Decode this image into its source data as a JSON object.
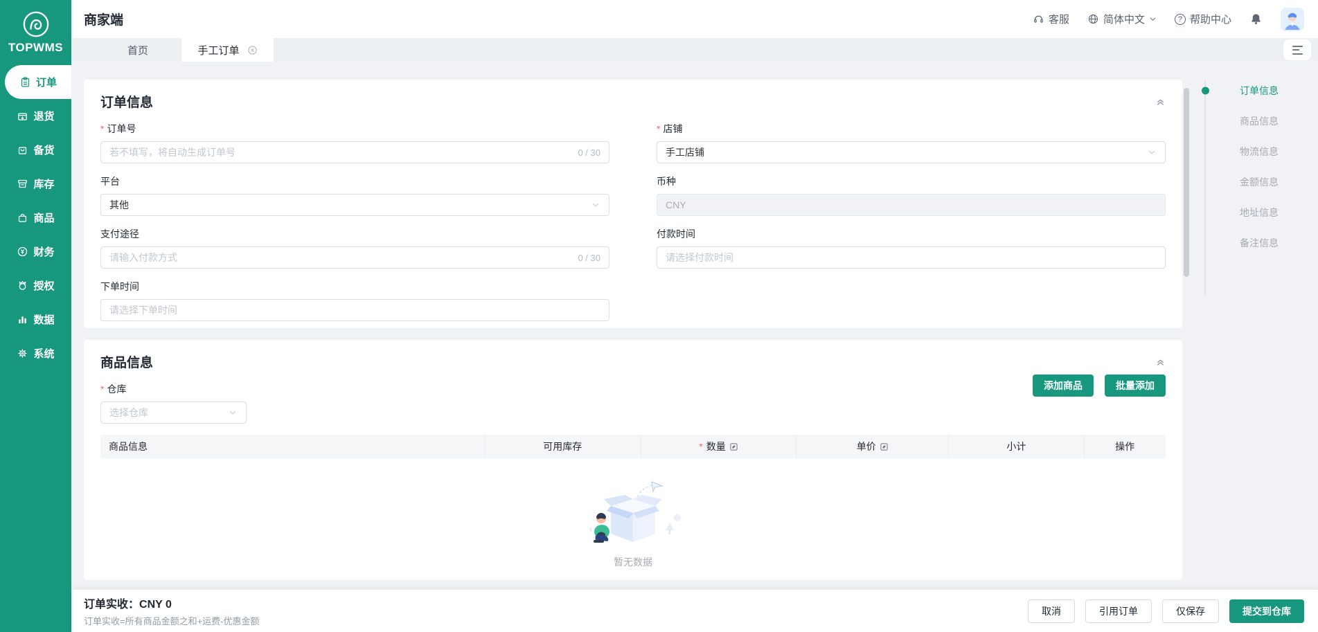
{
  "brand": {
    "name": "TOPWMS"
  },
  "topbar": {
    "title": "商家端",
    "customer_service": "客服",
    "language": "简体中文",
    "help_center": "帮助中心"
  },
  "tabs": [
    {
      "label": "首页",
      "active": false
    },
    {
      "label": "手工订单",
      "active": true,
      "closable": true
    }
  ],
  "sidebar": {
    "items": [
      {
        "label": "订单",
        "icon": "order-icon",
        "active": true
      },
      {
        "label": "退货",
        "icon": "returns-icon",
        "active": false
      },
      {
        "label": "备货",
        "icon": "stock-prep-icon",
        "active": false
      },
      {
        "label": "库存",
        "icon": "inventory-icon",
        "active": false
      },
      {
        "label": "商品",
        "icon": "product-icon",
        "active": false
      },
      {
        "label": "财务",
        "icon": "finance-icon",
        "active": false
      },
      {
        "label": "授权",
        "icon": "authorization-icon",
        "active": false
      },
      {
        "label": "数据",
        "icon": "data-icon",
        "active": false
      },
      {
        "label": "系统",
        "icon": "system-icon",
        "active": false
      }
    ]
  },
  "order_info": {
    "title": "订单信息",
    "order_no": {
      "label": "订单号",
      "placeholder": "若不填写，将自动生成订单号",
      "counter": "0 / 30",
      "required": true
    },
    "shop": {
      "label": "店铺",
      "value": "手工店铺",
      "required": true
    },
    "platform": {
      "label": "平台",
      "value": "其他"
    },
    "currency": {
      "label": "币种",
      "value": "CNY",
      "disabled": true
    },
    "payment_method": {
      "label": "支付途径",
      "placeholder": "请输入付款方式",
      "counter": "0 / 30"
    },
    "payment_time": {
      "label": "付款时间",
      "placeholder": "请选择付款时间"
    },
    "order_time": {
      "label": "下单时间",
      "placeholder": "请选择下单时间"
    }
  },
  "product_info": {
    "title": "商品信息",
    "warehouse": {
      "label": "仓库",
      "placeholder": "选择仓库",
      "required": true
    },
    "add_product_button": "添加商品",
    "batch_add_button": "批量添加",
    "table": {
      "columns": [
        "商品信息",
        "可用库存",
        "数量",
        "单价",
        "小计",
        "操作"
      ],
      "empty_text": "暂无数据"
    }
  },
  "anchor_nav": {
    "items": [
      {
        "label": "订单信息",
        "active": true
      },
      {
        "label": "商品信息",
        "active": false
      },
      {
        "label": "物流信息",
        "active": false
      },
      {
        "label": "金额信息",
        "active": false
      },
      {
        "label": "地址信息",
        "active": false
      },
      {
        "label": "备注信息",
        "active": false
      }
    ]
  },
  "footer": {
    "total_label": "订单实收：",
    "total_value": "CNY 0",
    "formula": "订单实收=所有商品金额之和+运费-优惠金额",
    "cancel_button": "取消",
    "reference_order_button": "引用订单",
    "save_only_button": "仅保存",
    "submit_button": "提交到仓库"
  },
  "ui": {
    "required_marker": "*",
    "help_glyph": "?"
  },
  "colors": {
    "brand_green": "#17987E",
    "page_bg": "#f0f2f5",
    "required_red": "#f56c6c",
    "placeholder_gray": "#c2c7cf"
  }
}
